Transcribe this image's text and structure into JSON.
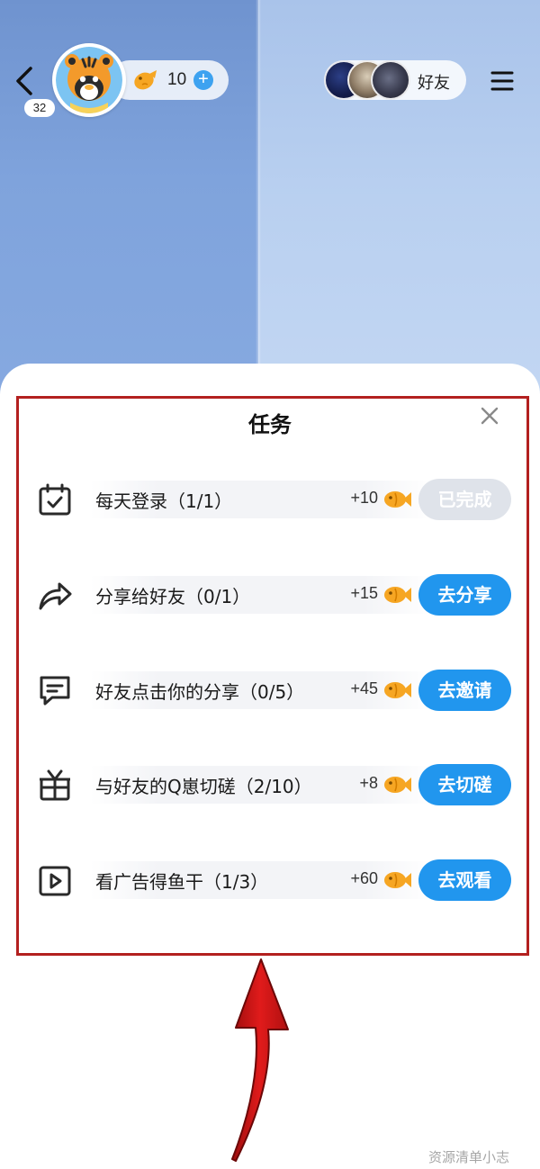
{
  "header": {
    "level": "32",
    "coin_count": "10",
    "plus_symbol": "+",
    "friends_label": "好友",
    "icons": {
      "back": "chevron-left-icon",
      "avatar": "tiger-avatar",
      "coin": "fish-coin-icon",
      "menu": "hamburger-menu-icon"
    }
  },
  "task_panel": {
    "title": "任务",
    "tasks": [
      {
        "label": "每天登录（1/1）",
        "reward": "+10",
        "button": "已完成",
        "completed": true,
        "icon": "calendar-check-icon"
      },
      {
        "label": "分享给好友（0/1）",
        "reward": "+15",
        "button": "去分享",
        "completed": false,
        "icon": "share-arrow-icon"
      },
      {
        "label": "好友点击你的分享（0/5）",
        "reward": "+45",
        "button": "去邀请",
        "completed": false,
        "icon": "chat-bubble-icon"
      },
      {
        "label": "与好友的Q崽切磋（2/10）",
        "reward": "+8",
        "button": "去切磋",
        "completed": false,
        "icon": "gift-box-icon"
      },
      {
        "label": "看广告得鱼干（1/3）",
        "reward": "+60",
        "button": "去观看",
        "completed": false,
        "icon": "play-video-icon"
      }
    ]
  },
  "watermark": "资源清单小志",
  "colors": {
    "accent_blue": "#2196ee",
    "done_gray": "#dfe3ea",
    "highlight_red": "#b3201f"
  }
}
